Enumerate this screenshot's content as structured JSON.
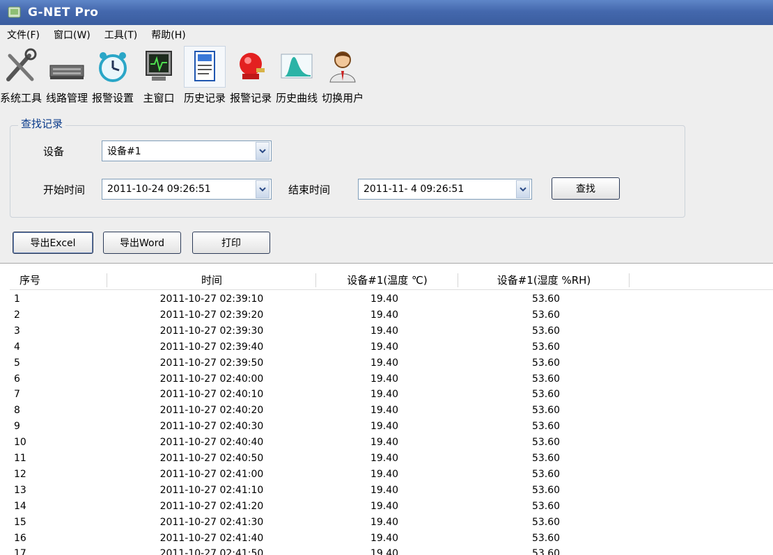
{
  "window": {
    "title": "G-NET Pro"
  },
  "menu": [
    "文件(F)",
    "窗口(W)",
    "工具(T)",
    "帮助(H)"
  ],
  "toolbar": [
    {
      "label": "系统工具",
      "icon": "tools-icon"
    },
    {
      "label": "线路管理",
      "icon": "router-icon"
    },
    {
      "label": "报警设置",
      "icon": "alarm-clock-icon"
    },
    {
      "label": "主窗口",
      "icon": "monitor-icon"
    },
    {
      "label": "历史记录",
      "icon": "document-icon"
    },
    {
      "label": "报警记录",
      "icon": "alarm-bell-icon"
    },
    {
      "label": "历史曲线",
      "icon": "chart-icon"
    },
    {
      "label": "切换用户",
      "icon": "user-icon"
    }
  ],
  "search": {
    "group_title": "查找记录",
    "device_label": "设备",
    "device_value": "设备#1",
    "start_label": "开始时间",
    "start_value": "2011-10-24 09:26:51",
    "end_label": "结束时间",
    "end_value": "2011-11- 4 09:26:51",
    "find_button": "查找"
  },
  "actions": {
    "export_excel": "导出Excel",
    "export_word": "导出Word",
    "print": "打印"
  },
  "table": {
    "headers": [
      "序号",
      "时间",
      "设备#1(温度 ℃)",
      "设备#1(湿度 %RH)"
    ],
    "rows": [
      [
        "1",
        "2011-10-27 02:39:10",
        "19.40",
        "53.60"
      ],
      [
        "2",
        "2011-10-27 02:39:20",
        "19.40",
        "53.60"
      ],
      [
        "3",
        "2011-10-27 02:39:30",
        "19.40",
        "53.60"
      ],
      [
        "4",
        "2011-10-27 02:39:40",
        "19.40",
        "53.60"
      ],
      [
        "5",
        "2011-10-27 02:39:50",
        "19.40",
        "53.60"
      ],
      [
        "6",
        "2011-10-27 02:40:00",
        "19.40",
        "53.60"
      ],
      [
        "7",
        "2011-10-27 02:40:10",
        "19.40",
        "53.60"
      ],
      [
        "8",
        "2011-10-27 02:40:20",
        "19.40",
        "53.60"
      ],
      [
        "9",
        "2011-10-27 02:40:30",
        "19.40",
        "53.60"
      ],
      [
        "10",
        "2011-10-27 02:40:40",
        "19.40",
        "53.60"
      ],
      [
        "11",
        "2011-10-27 02:40:50",
        "19.40",
        "53.60"
      ],
      [
        "12",
        "2011-10-27 02:41:00",
        "19.40",
        "53.60"
      ],
      [
        "13",
        "2011-10-27 02:41:10",
        "19.40",
        "53.60"
      ],
      [
        "14",
        "2011-10-27 02:41:20",
        "19.40",
        "53.60"
      ],
      [
        "15",
        "2011-10-27 02:41:30",
        "19.40",
        "53.60"
      ],
      [
        "16",
        "2011-10-27 02:41:40",
        "19.40",
        "53.60"
      ],
      [
        "17",
        "2011-10-27 02:41:50",
        "19.40",
        "53.60"
      ]
    ]
  }
}
